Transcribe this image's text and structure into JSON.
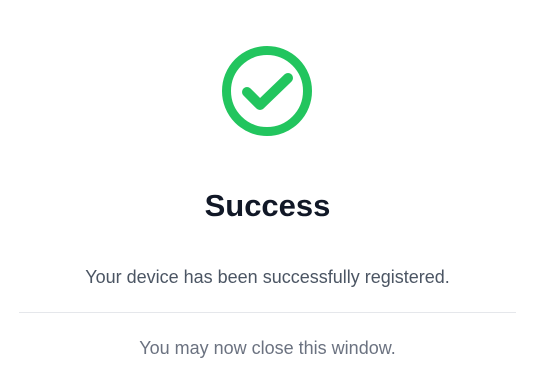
{
  "status": {
    "icon": "check-circle-icon",
    "color": "#22c55e",
    "title": "Success",
    "message": "Your device has been successfully registered."
  },
  "footer": {
    "note": "You may now close this window."
  }
}
